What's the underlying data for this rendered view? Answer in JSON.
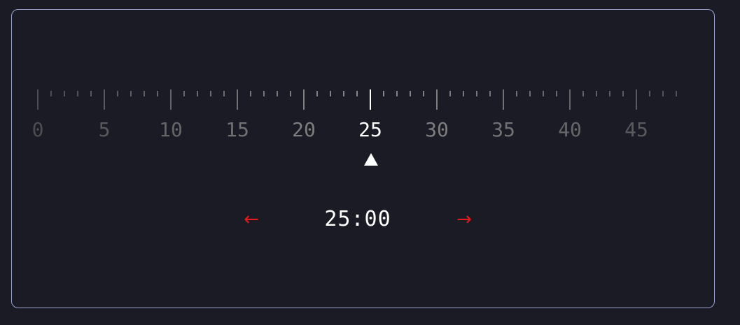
{
  "ruler": {
    "min": 0,
    "max": 48,
    "major_step": 5,
    "selected": 25,
    "labels": [
      "0",
      "5",
      "10",
      "15",
      "20",
      "25",
      "30",
      "35",
      "40",
      "45"
    ],
    "tick_color": "#8a8a8a",
    "selected_color": "#ffffff"
  },
  "display": {
    "time": "25:00"
  },
  "controls": {
    "prev_label": "←",
    "next_label": "→",
    "arrow_color": "#e31b1b"
  },
  "panel": {
    "border_color": "#9aa3cf",
    "background": "#1b1b25"
  }
}
